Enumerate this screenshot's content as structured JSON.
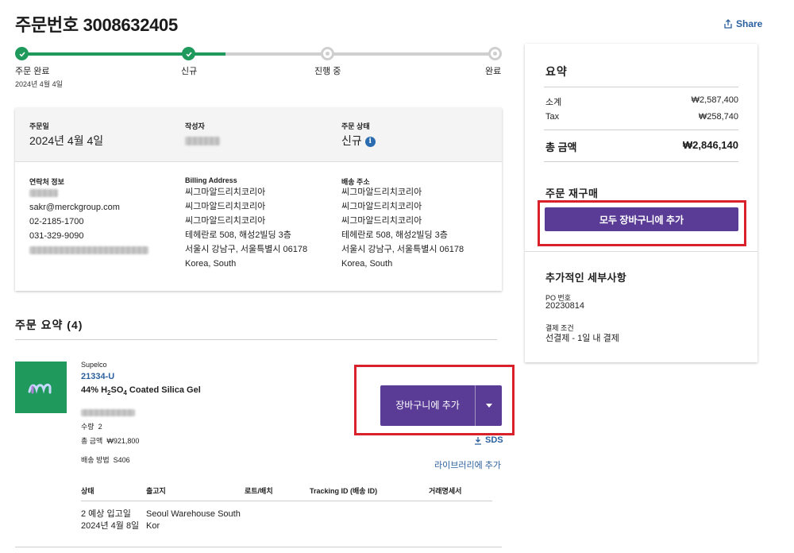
{
  "header": {
    "order_label": "주문번호",
    "order_number": "3008632405",
    "share_label": "Share"
  },
  "progress": {
    "steps": [
      {
        "label": "주문 완료",
        "state": "done"
      },
      {
        "label": "신규",
        "state": "done"
      },
      {
        "label": "진행 중",
        "state": "todo"
      },
      {
        "label": "완료",
        "state": "todo"
      }
    ],
    "first_step_date": "2024년 4월 4일",
    "fill_fraction": 0.43
  },
  "order_info": {
    "order_date_label": "주문일",
    "order_date": "2024년 4월 4일",
    "creator_label": "작성자",
    "status_label": "주문 상태",
    "status": "신규",
    "status_info_icon": "info-icon",
    "contact_label": "연락처 정보",
    "contact_email": "sakr@merckgroup.com",
    "contact_phone1": "02-2185-1700",
    "contact_phone2": "031-329-9090",
    "billing_label": "Billing Address",
    "billing_lines": [
      "씨그마알드리치코리아",
      "씨그마알드리치코리아",
      "씨그마알드리치코리아",
      "테헤란로 508, 해성2빌딩 3층",
      "서울시 강남구, 서울특별시 06178",
      "Korea, South"
    ],
    "shipping_label": "배송 주소",
    "shipping_lines": [
      "씨그마알드리치코리아",
      "씨그마알드리치코리아",
      "씨그마알드리치코리아",
      "테헤란로 508, 해성2빌딩 3층",
      "서울시 강남구, 서울특별시 06178",
      "Korea, South"
    ]
  },
  "order_summary": {
    "heading": "주문 요약 (4)"
  },
  "product": {
    "brand": "Supelco",
    "code": "21334-U",
    "name_prefix": "44% H",
    "name_sub1": "2",
    "name_mid": "SO",
    "name_sub2": "4",
    "name_suffix": " Coated Silica Gel",
    "qty_label": "수량",
    "qty": "2",
    "total_label": "총 금액",
    "total": "₩921,800",
    "ship_label": "배송 방법",
    "ship_value": "S406",
    "add_to_cart": "장바구니에 추가",
    "sds_label": "SDS",
    "library_link": "라이브러리에 추가"
  },
  "shipment_table": {
    "headers": [
      "상태",
      "출고지",
      "로트/배치",
      "Tracking ID (배송 ID)",
      "거래명세서"
    ],
    "row": {
      "status_line1": "2 예상 입고일",
      "status_line2": "2024년 4월 8일",
      "warehouse_line1": "Seoul Warehouse South",
      "warehouse_line2": "Kor"
    }
  },
  "sidebar": {
    "summary_title": "요약",
    "subtotal_label": "소계",
    "subtotal": "₩2,587,400",
    "tax_label": "Tax",
    "tax": "₩258,740",
    "total_label": "총 금액",
    "total": "₩2,846,140",
    "reorder_title": "주문 재구매",
    "reorder_button": "모두 장바구니에 추가",
    "details_title": "추가적인 세부사항",
    "po_label": "PO 번호",
    "po_value": "20230814",
    "payment_label": "결제 조건",
    "payment_value": "선결제 - 1일 내 결제"
  },
  "colors": {
    "accent_purple": "#5a3c96",
    "success_green": "#1f9a5c",
    "link_blue": "#2b5f9e",
    "highlight_red": "#d9212c"
  }
}
